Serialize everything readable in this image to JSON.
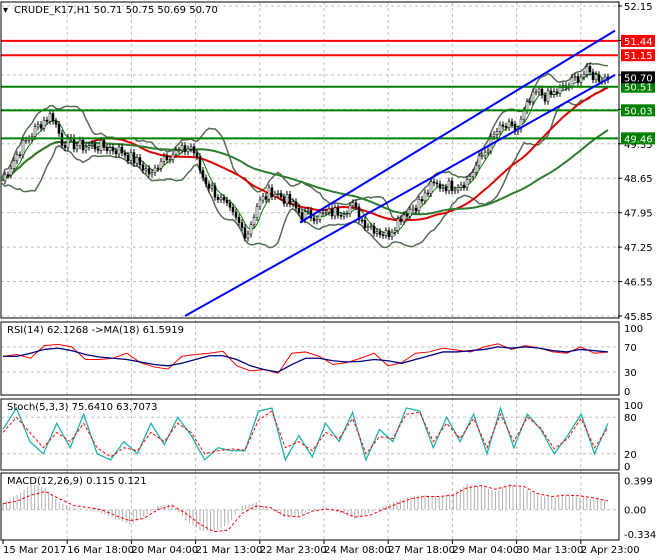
{
  "chart_data": {
    "type": "line",
    "title": "CRUDE_K17,H1  50.71 50.75 50.69 50.70",
    "symbol": "CRUDE_K17,H1",
    "ohlc": [
      "50.71",
      "50.75",
      "50.69",
      "50.70"
    ],
    "price_axis": {
      "ticks": [
        "52.15",
        "48.65",
        "47.95",
        "47.25",
        "46.55",
        "45.85",
        "49.35"
      ],
      "ylim": [
        45.85,
        52.15
      ]
    },
    "levels": [
      {
        "value": "51.44",
        "color": "#ff0000"
      },
      {
        "value": "51.15",
        "color": "#ff0000"
      },
      {
        "value": "50.51",
        "color": "#008000"
      },
      {
        "value": "50.03",
        "color": "#008000"
      },
      {
        "value": "49.46",
        "color": "#008000"
      }
    ],
    "current_price": "50.70",
    "price_x": [
      0,
      20,
      40,
      50,
      60,
      80,
      100,
      120,
      140,
      150,
      160,
      180,
      190,
      200,
      215,
      230,
      245,
      255,
      270,
      285,
      300,
      320,
      340,
      350,
      360,
      375,
      385,
      400,
      420,
      430,
      450,
      465,
      480,
      495,
      505,
      515,
      525,
      535,
      545,
      555,
      565,
      575,
      585,
      595,
      608
    ],
    "price_y": [
      48.6,
      49.3,
      49.8,
      49.95,
      49.4,
      49.3,
      49.3,
      49.2,
      48.9,
      48.7,
      49.1,
      49.2,
      49.3,
      48.7,
      48.3,
      47.9,
      47.5,
      48.1,
      48.4,
      48.2,
      47.9,
      47.9,
      48.0,
      48.1,
      47.8,
      47.6,
      47.5,
      47.9,
      48.2,
      48.5,
      48.5,
      48.6,
      49.1,
      49.6,
      49.7,
      49.6,
      50.1,
      50.4,
      50.3,
      50.4,
      50.5,
      50.7,
      50.8,
      50.7,
      50.7
    ],
    "channel": {
      "upper": [
        [
          300,
          47.75
        ],
        [
          615,
          51.65
        ]
      ],
      "lower": [
        [
          185,
          45.85
        ],
        [
          615,
          50.75
        ]
      ]
    },
    "time_labels": [
      "15 Mar 2017",
      "16 Mar 18:00",
      "20 Mar 04:00",
      "21 Mar 13:00",
      "22 Mar 23:00",
      "24 Mar 08:00",
      "27 Mar 18:00",
      "29 Mar 04:00",
      "30 Mar 13:00",
      "2 Apr 23:00"
    ],
    "rsi": {
      "label": "RSI(14) 62.1268  ->MA(18) 61.5919",
      "ticks": [
        "100",
        "70",
        "30",
        "0"
      ],
      "values": [
        55,
        58,
        52,
        72,
        74,
        70,
        50,
        50,
        52,
        60,
        45,
        38,
        35,
        55,
        58,
        60,
        63,
        40,
        32,
        34,
        28,
        60,
        62,
        55,
        42,
        45,
        52,
        60,
        40,
        45,
        60,
        62,
        68,
        65,
        62,
        70,
        75,
        66,
        72,
        68,
        62,
        60,
        70,
        60,
        62
      ],
      "ma": [
        55,
        55,
        60,
        66,
        68,
        64,
        58,
        54,
        52,
        50,
        46,
        42,
        40,
        44,
        50,
        56,
        56,
        50,
        40,
        34,
        30,
        42,
        52,
        52,
        48,
        46,
        47,
        50,
        48,
        44,
        50,
        56,
        62,
        62,
        64,
        66,
        70,
        68,
        70,
        68,
        64,
        62,
        66,
        64,
        62
      ]
    },
    "stoch": {
      "label": "Stoch(5,3,3) 75.6410 63.7073",
      "ticks": [
        "100",
        "80",
        "20",
        "0"
      ],
      "main": [
        60,
        95,
        40,
        20,
        70,
        30,
        85,
        20,
        10,
        40,
        20,
        70,
        35,
        80,
        50,
        10,
        30,
        25,
        25,
        90,
        95,
        10,
        50,
        15,
        70,
        40,
        88,
        10,
        60,
        40,
        95,
        90,
        30,
        80,
        40,
        85,
        20,
        95,
        30,
        85,
        60,
        20,
        50,
        85,
        20,
        70
      ],
      "signal": [
        55,
        80,
        55,
        30,
        55,
        40,
        70,
        30,
        15,
        30,
        25,
        55,
        40,
        70,
        55,
        20,
        25,
        28,
        26,
        75,
        90,
        30,
        40,
        25,
        55,
        45,
        78,
        20,
        48,
        45,
        85,
        88,
        40,
        70,
        45,
        78,
        30,
        85,
        40,
        80,
        62,
        28,
        45,
        78,
        30,
        63
      ]
    },
    "macd": {
      "label": "MACD(12,26,9) 0.115 0.121",
      "ticks": [
        "0.399",
        "0.00",
        "-0.334"
      ],
      "hist": [
        0.1,
        0.2,
        0.35,
        0.3,
        0.1,
        0.02,
        0,
        -0.05,
        -0.12,
        -0.2,
        -0.1,
        0.05,
        0.08,
        -0.15,
        -0.28,
        -0.3,
        -0.2,
        0.05,
        0.1,
        0,
        -0.1,
        -0.08,
        0,
        0.02,
        -0.05,
        -0.12,
        -0.05,
        0.05,
        0.12,
        0.18,
        0.2,
        0.18,
        0.22,
        0.35,
        0.32,
        0.25,
        0.35,
        0.3,
        0.2,
        0.17,
        0.2,
        0.17,
        0.15,
        0.12
      ],
      "signal": [
        0.08,
        0.12,
        0.2,
        0.25,
        0.15,
        0.06,
        0.03,
        0,
        -0.08,
        -0.15,
        -0.12,
        0,
        0.06,
        -0.05,
        -0.2,
        -0.3,
        -0.28,
        -0.05,
        0.05,
        0.03,
        -0.08,
        -0.1,
        -0.02,
        0.01,
        -0.02,
        -0.1,
        -0.08,
        0,
        0.08,
        0.15,
        0.18,
        0.18,
        0.2,
        0.3,
        0.33,
        0.28,
        0.33,
        0.32,
        0.22,
        0.18,
        0.2,
        0.19,
        0.16,
        0.12
      ]
    }
  }
}
